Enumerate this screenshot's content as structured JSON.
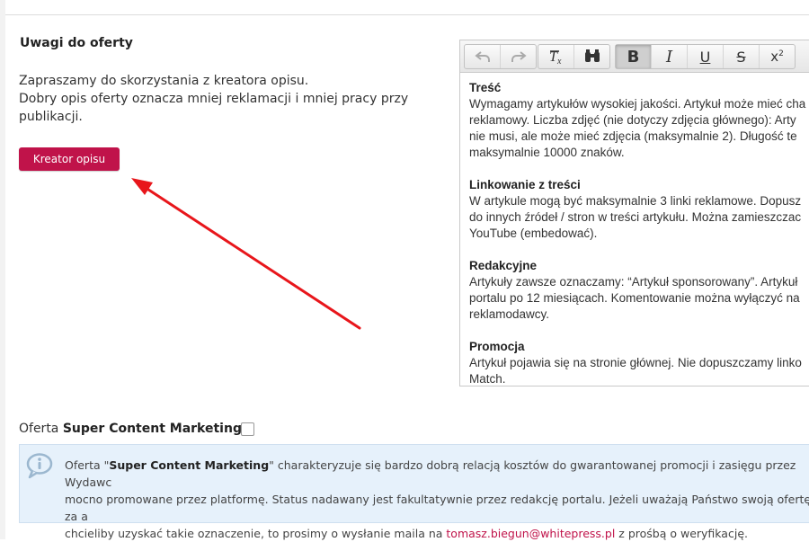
{
  "section": {
    "title": "Uwagi do oferty",
    "intro_line1": "Zapraszamy do skorzystania z kreatora opisu.",
    "intro_line2": "Dobry opis oferty oznacza mniej reklamacji i mniej pracy przy publikacji.",
    "creator_button": "Kreator opisu"
  },
  "editor": {
    "toolbar": [
      {
        "name": "undo-icon",
        "glyph": "↶"
      },
      {
        "name": "redo-icon",
        "glyph": "↷"
      },
      {
        "name": "remove-format-icon",
        "glyph": "Tx"
      },
      {
        "name": "find-icon",
        "glyph": "binoculars"
      },
      {
        "name": "bold-icon",
        "glyph": "B"
      },
      {
        "name": "italic-icon",
        "glyph": "I"
      },
      {
        "name": "underline-icon",
        "glyph": "U"
      },
      {
        "name": "strikethrough-icon",
        "glyph": "S"
      },
      {
        "name": "superscript-icon",
        "glyph": "x²"
      }
    ],
    "sections": [
      {
        "heading": "Treść",
        "body": "Wymagamy artykułów wysokiej jakości. Artykuł może mieć cha\nreklamowy. Liczba zdjęć (nie dotyczy zdjęcia głównego): Arty\nnie musi, ale może mieć zdjęcia (maksymalnie 2). Długość te\nmaksymalnie 10000 znaków."
      },
      {
        "heading": "Linkowanie z treści",
        "body": "W artykule mogą być maksymalnie 3 linki reklamowe. Dopusz\ndo innych źródeł / stron w treści artykułu. Można zamieszczac\nYouTube (embedować)."
      },
      {
        "heading": "Redakcyjne",
        "body": "Artykuły zawsze oznaczamy: “Artykuł sponsorowany”. Artykuł\nportalu po 12 miesiącach. Komentowanie można wyłączyć na\nreklamodawcy."
      },
      {
        "heading": "Promocja",
        "body": "Artykuł pojawia się na stronie głównej. Nie dopuszczamy linko\nMatch."
      }
    ]
  },
  "super_content": {
    "label_prefix": "Oferta",
    "label_bold": "Super Content Marketing",
    "checked": false,
    "info_pre": "Oferta \"",
    "info_bold": "Super Content Marketing",
    "info_post": "\" charakteryzuje się bardzo dobrą relacją kosztów do gwarantowanej promocji i zasięgu przez Wydawc\nmocno promowane przez platformę. Status nadawany jest fakultatywnie przez redakcję portalu. Jeżeli uważają Państwo swoją ofertę za a\nchcieliby uzyskać takie oznaczenie, to prosimy o wysłanie maila na ",
    "email": "tomasz.biegun@whitepress.pl",
    "info_end": " z prośbą o weryfikację."
  },
  "colors": {
    "accent": "#c0134a",
    "info_bg": "#e6f1fb",
    "arrow": "#e8161b"
  }
}
